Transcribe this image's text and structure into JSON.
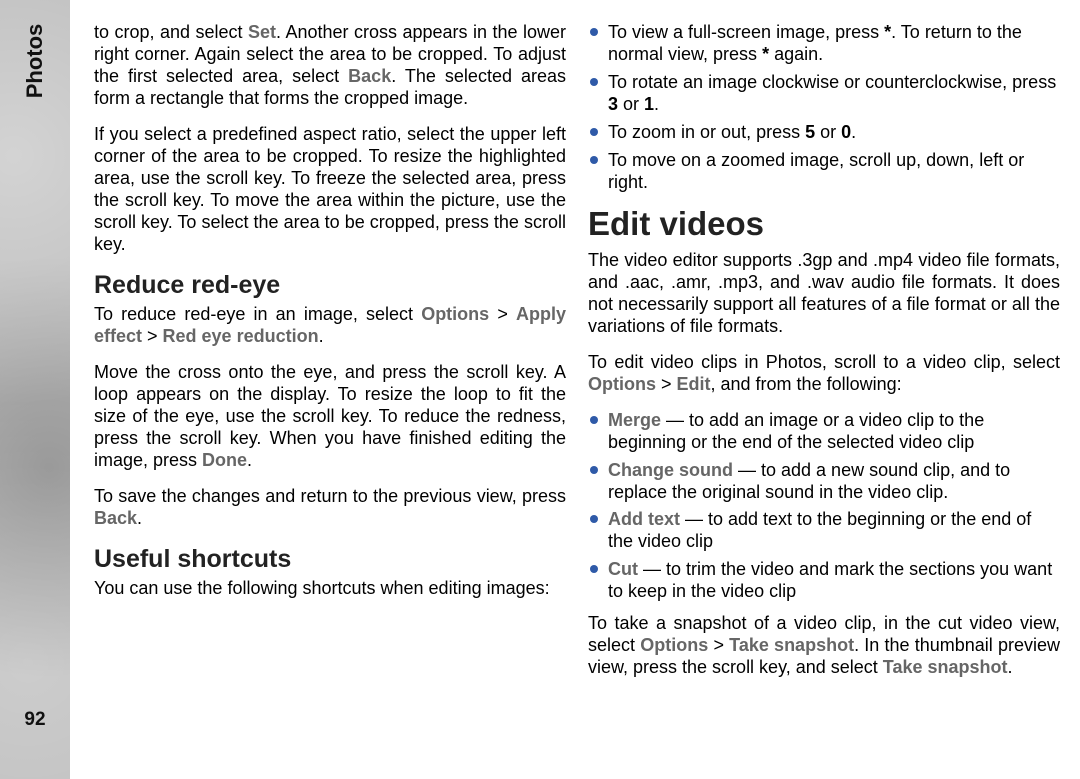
{
  "sidebar": {
    "section_label": "Photos",
    "page_number": "92"
  },
  "col1": {
    "p_crop": {
      "t1": "to crop, and select ",
      "set": "Set",
      "t2": ". Another cross appears in the lower right corner. Again select the area to be cropped. To adjust the first selected area, select ",
      "back": "Back",
      "t3": ". The selected areas form a rectangle that forms the cropped image."
    },
    "p_aspect": "If you select a predefined aspect ratio, select the upper left corner of the area to be cropped. To resize the highlighted area, use the scroll key. To freeze the selected area, press the scroll key. To move the area within the picture, use the scroll key. To select the area to be cropped, press the scroll key.",
    "h_redeye": "Reduce red-eye",
    "p_redeye_path": {
      "t1": "To reduce red-eye in an image, select ",
      "opt": "Options",
      "gt1": " > ",
      "apply": "Apply effect",
      "gt2": " > ",
      "red": "Red eye reduction",
      "t2": "."
    },
    "p_redeye_steps": {
      "t1": "Move the cross onto the eye, and press the scroll key. A loop appears on the display. To resize the loop to fit the size of the eye, use the scroll key. To reduce the redness, press the scroll key. When you have finished editing the image, press ",
      "done": "Done",
      "t2": "."
    },
    "p_save": {
      "t1": "To save the changes and return to the previous view, press ",
      "back": "Back",
      "t2": "."
    },
    "h_shortcuts": "Useful shortcuts",
    "p_shortcuts_intro": "You can use the following shortcuts when editing images:"
  },
  "col2": {
    "bullets_shortcuts": {
      "b1a": "To view a full-screen image, press ",
      "b1star1": "*",
      "b1b": ". To return to the normal view, press ",
      "b1star2": "*",
      "b1c": " again.",
      "b2a": "To rotate an image clockwise or counterclockwise, press ",
      "b2k3": "3",
      "b2b": " or ",
      "b2k1": "1",
      "b2c": ".",
      "b3a": "To zoom in or out, press ",
      "b3k5": "5",
      "b3b": " or ",
      "b3k0": "0",
      "b3c": ".",
      "b4": "To move on a zoomed image, scroll up, down, left or right."
    },
    "h_editvideos": "Edit videos",
    "p_formats": "The video editor supports .3gp and .mp4 video file formats, and .aac, .amr, .mp3, and .wav audio file formats. It does not necessarily support all features of a file format or all the variations of file formats.",
    "p_editclips": {
      "t1": "To edit video clips in Photos, scroll to a video clip, select ",
      "opt": "Options",
      "gt": " > ",
      "edit": "Edit",
      "t2": ", and from the following:"
    },
    "bullets_edit": {
      "merge_k": "Merge",
      "merge_t": " — to add an image or a video clip to the beginning or the end of the selected video clip",
      "sound_k": "Change sound",
      "sound_t": " — to add a new sound clip, and to replace the original sound in the video clip.",
      "text_k": "Add text",
      "text_t": " — to add text to the beginning or the end of the video clip",
      "cut_k": "Cut",
      "cut_t": " — to trim the video and mark the sections you want to keep in the video clip"
    },
    "p_snapshot": {
      "t1": "To take a snapshot of a video clip, in the cut video view, select ",
      "opt": "Options",
      "gt": " > ",
      "ts1": "Take snapshot",
      "t2": ". In the thumbnail preview view, press the scroll key, and select ",
      "ts2": "Take snapshot",
      "t3": "."
    }
  }
}
